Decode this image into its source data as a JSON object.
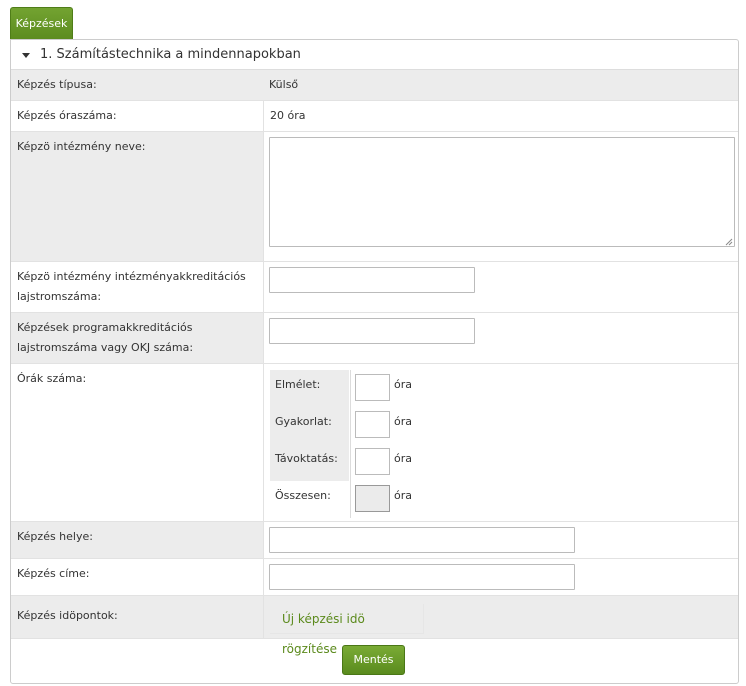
{
  "tab": {
    "label": "Képzések"
  },
  "section": {
    "title": "1. Számítástechnika a mindennapokban"
  },
  "fields": {
    "tipus": {
      "label": "Képzés típusa:",
      "value": "Külső"
    },
    "oraszam": {
      "label": "Képzés óraszáma:",
      "value": "20 óra"
    },
    "intezmeny_neve": {
      "label": "Képzö intézmény neve:",
      "value": ""
    },
    "akkreditacio": {
      "label": "Képzö intézmény intézményakkreditációs lajstromszáma:",
      "value": ""
    },
    "program": {
      "label": "Képzések programakkreditációs lajstromszáma vagy OKJ száma:",
      "value": ""
    },
    "orak": {
      "label": "Órák száma:",
      "rows": [
        {
          "label": "Elmélet:",
          "value": "",
          "unit": "óra"
        },
        {
          "label": "Gyakorlat:",
          "value": "",
          "unit": "óra"
        },
        {
          "label": "Távoktatás:",
          "value": "",
          "unit": "óra"
        },
        {
          "label": "Összesen:",
          "value": "",
          "unit": "óra"
        }
      ]
    },
    "helye": {
      "label": "Képzés helye:",
      "value": ""
    },
    "cime": {
      "label": "Képzés címe:",
      "value": ""
    },
    "idopontok": {
      "label": "Képzés idöpontok:",
      "link": "Új képzési idö rögzítése"
    }
  },
  "buttons": {
    "save": "Mentés"
  },
  "colors": {
    "accent": "#6a9a2a",
    "row_gray": "#ececec"
  }
}
